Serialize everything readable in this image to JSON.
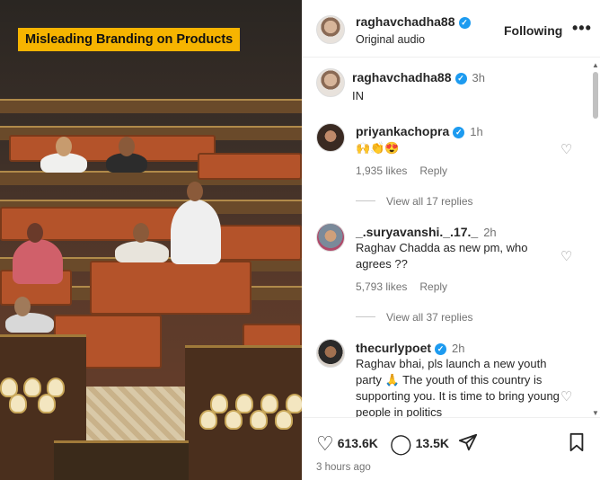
{
  "media": {
    "banner": "Misleading Branding on Products"
  },
  "header": {
    "username": "raghavchadha88",
    "subtitle": "Original audio",
    "follow_label": "Following",
    "more_label": "•••"
  },
  "caption": {
    "username": "raghavchadha88",
    "time": "3h",
    "text": "IN"
  },
  "comments": [
    {
      "username": "priyankachopra",
      "verified": true,
      "time": "1h",
      "text": "🙌👏😍",
      "likes": "1,935 likes",
      "reply": "Reply",
      "view_replies": "View all 17 replies"
    },
    {
      "username": "_.suryavanshi._.17._",
      "verified": false,
      "time": "2h",
      "text": "Raghav Chadda as new pm, who agrees ??",
      "likes": "5,793 likes",
      "reply": "Reply",
      "view_replies": "View all 37 replies"
    },
    {
      "username": "thecurlypoet",
      "verified": true,
      "time": "2h",
      "text": "Raghav bhai, pls launch a new youth party 🙏 The youth of this country is supporting you. It is time to bring young people in politics"
    }
  ],
  "actions": {
    "likes": "613.6K",
    "comments": "13.5K",
    "posted": "3 hours ago"
  },
  "icons": {
    "heart": "heart-icon",
    "comment": "comment-icon",
    "share": "share-icon",
    "save": "bookmark-icon",
    "verified": "verified-badge-icon"
  },
  "colors": {
    "banner": "#f6b400",
    "verified": "#1d9bf0"
  }
}
